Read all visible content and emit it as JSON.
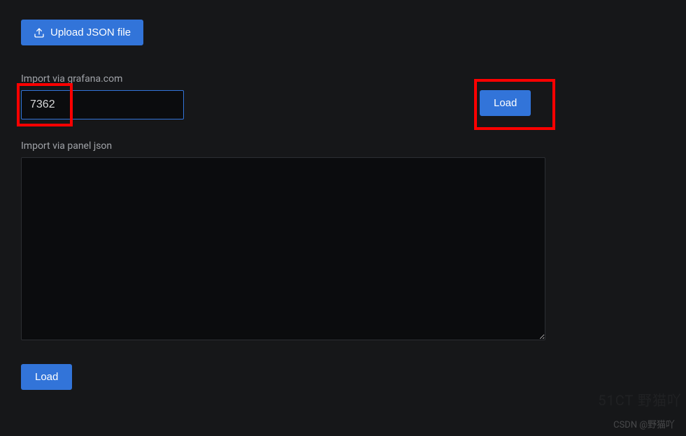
{
  "upload": {
    "button_label": "Upload JSON file"
  },
  "grafana_import": {
    "label": "Import via grafana.com",
    "input_value": "7362",
    "load_label": "Load"
  },
  "panel_json": {
    "label": "Import via panel json",
    "textarea_value": ""
  },
  "bottom": {
    "load_label": "Load"
  },
  "watermark": {
    "text": "CSDN @野猫吖",
    "faint": "51CT 野猫吖"
  }
}
